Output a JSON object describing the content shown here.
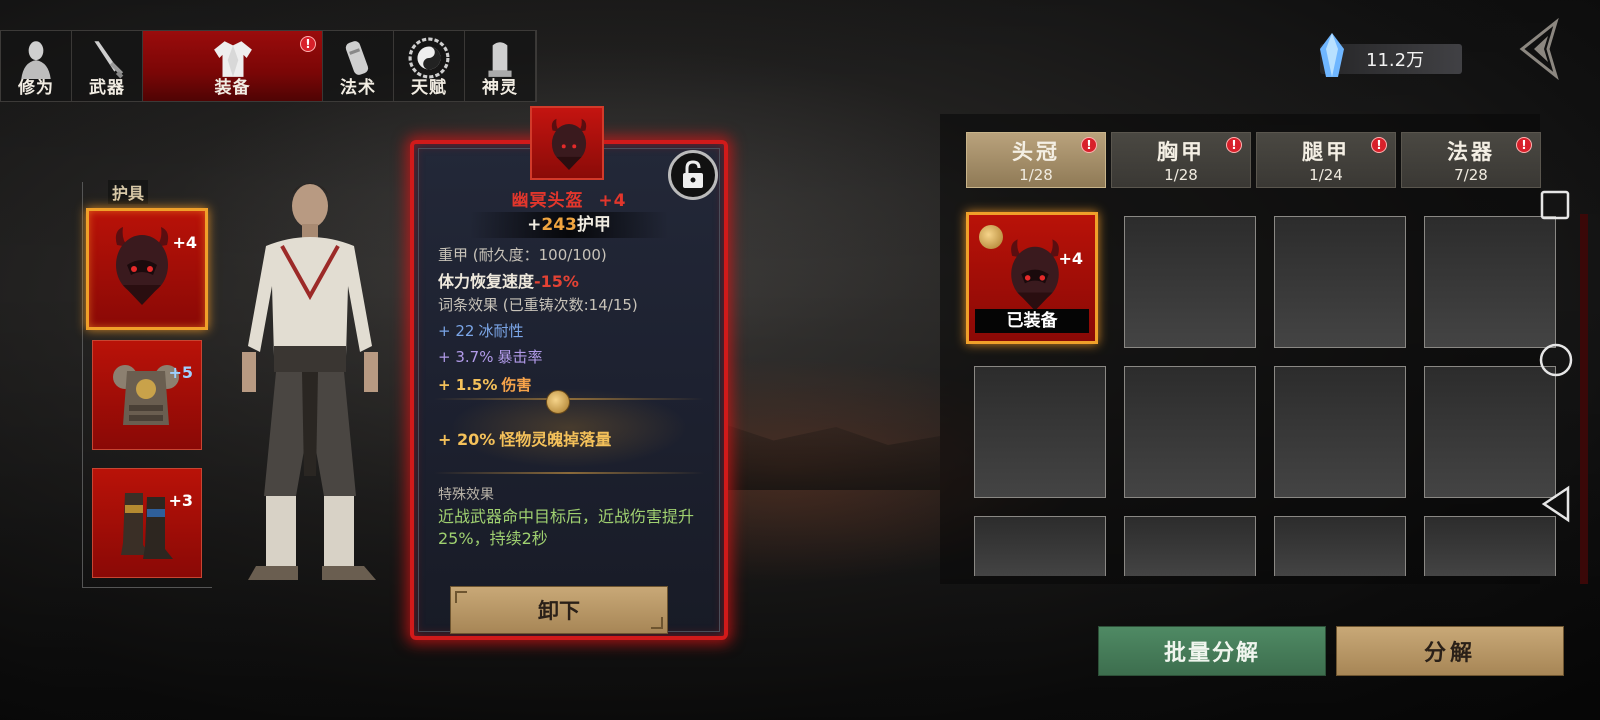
{
  "top_tabs": [
    {
      "label": "修为",
      "icon": "meditation-icon"
    },
    {
      "label": "武器",
      "icon": "sword-icon"
    },
    {
      "label": "装备",
      "icon": "robe-icon",
      "active": true,
      "badge": "!"
    },
    {
      "label": "法术",
      "icon": "scroll-icon"
    },
    {
      "label": "天赋",
      "icon": "taiji-icon"
    },
    {
      "label": "神灵",
      "icon": "tablet-icon"
    }
  ],
  "currency": {
    "amount": "11.2万",
    "icon": "crystal-icon"
  },
  "armor_panel": {
    "title": "护具",
    "slots": [
      {
        "name": "helmet",
        "level": "+4",
        "selected": true
      },
      {
        "name": "chest",
        "level": "+5"
      },
      {
        "name": "boots",
        "level": "+3"
      }
    ]
  },
  "tooltip": {
    "name": "幽冥头盔",
    "level": "+4",
    "armor_prefix": "+",
    "armor_value": "243",
    "armor_label": "护甲",
    "type_line": "重甲 (耐久度：100/100)",
    "stamina_label": "体力恢复速度",
    "stamina_value": "-15%",
    "affix_header": "词条效果 (已重铸次数:14/15)",
    "affixes": [
      {
        "value": "+ 22",
        "text": "冰耐性"
      },
      {
        "value": "+ 3.7%",
        "text": "暴击率"
      },
      {
        "value": "+ 1.5%",
        "text": "伤害"
      },
      {
        "value": "+ 20%",
        "text": "怪物灵魄掉落量"
      }
    ],
    "special_title": "特殊效果",
    "special_text": "近战武器命中目标后，近战伤害提升25%，持续2秒",
    "unequip_label": "卸下"
  },
  "categories": [
    {
      "name": "头冠",
      "count": "1/28",
      "active": true,
      "badge": "!"
    },
    {
      "name": "胸甲",
      "count": "1/28",
      "badge": "!"
    },
    {
      "name": "腿甲",
      "count": "1/24",
      "badge": "!"
    },
    {
      "name": "法器",
      "count": "7/28",
      "badge": "!"
    }
  ],
  "grid": {
    "equipped_item": {
      "level": "+4",
      "tag": "已装备"
    }
  },
  "buttons": {
    "batch": "批量分解",
    "decompose": "分解"
  },
  "colors": {
    "accent_red": "#b91208",
    "gold_border": "#f0a02a",
    "button_tan": "#c8a877",
    "button_green": "#4f8a64"
  }
}
